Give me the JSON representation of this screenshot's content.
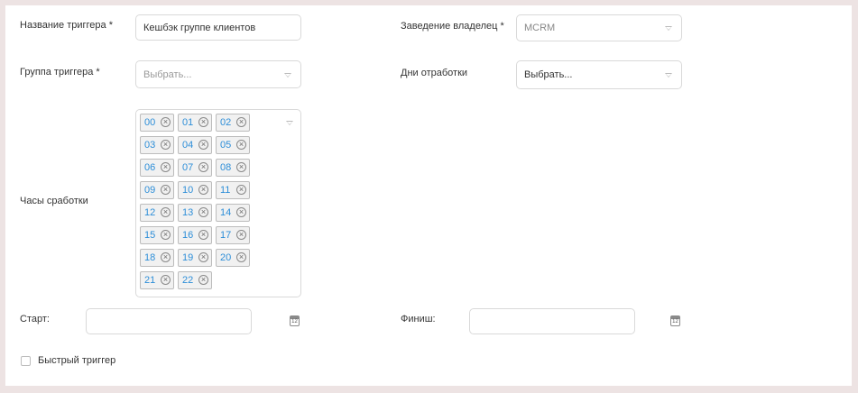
{
  "form": {
    "trigger_name_label": "Название триггера *",
    "trigger_name_value": "Кешбэк группе клиентов",
    "owner_label": "Заведение владелец *",
    "owner_value": "MCRM",
    "trigger_group_label": "Группа триггера *",
    "trigger_group_placeholder": "Выбрать...",
    "work_days_label": "Дни отработки",
    "work_days_placeholder": "Выбрать...",
    "work_hours_label": "Часы сработки",
    "work_hours_tags": [
      "00",
      "01",
      "02",
      "03",
      "04",
      "05",
      "06",
      "07",
      "08",
      "09",
      "10",
      "11",
      "12",
      "13",
      "14",
      "15",
      "16",
      "17",
      "18",
      "19",
      "20",
      "21",
      "22"
    ],
    "start_label": "Старт:",
    "start_value": "",
    "finish_label": "Финиш:",
    "finish_value": "",
    "calendar_day": "12",
    "fast_trigger_label": "Быстрый триггер",
    "fast_trigger_checked": false,
    "tag_remove_glyph": "×"
  },
  "icons": {
    "dropdown": "chevron-down-icon",
    "tag_remove": "close-circle-icon",
    "date": "calendar-icon"
  },
  "colors": {
    "tag_text": "#2d8ed8",
    "background": "#ede3e3",
    "border": "#d9d9d9"
  }
}
